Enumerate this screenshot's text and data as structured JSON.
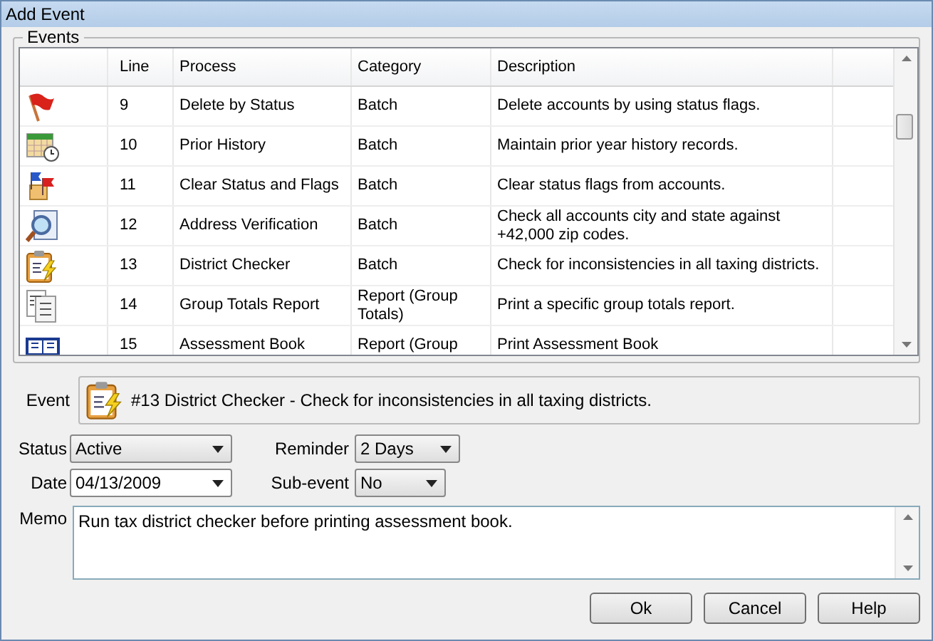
{
  "window": {
    "title": "Add Event"
  },
  "events": {
    "label": "Events",
    "columns": [
      "Line",
      "Process",
      "Category",
      "Description"
    ],
    "rows": [
      {
        "kind": "flag",
        "line": "9",
        "process": "Delete by Status",
        "category": "Batch",
        "description": "Delete accounts by using status flags."
      },
      {
        "kind": "calendar",
        "line": "10",
        "process": "Prior History",
        "category": "Batch",
        "description": "Maintain prior year history records."
      },
      {
        "kind": "flags",
        "line": "11",
        "process": "Clear Status and Flags",
        "category": "Batch",
        "description": "Clear status flags from accounts."
      },
      {
        "kind": "magnifier",
        "line": "12",
        "process": "Address Verification",
        "category": "Batch",
        "description": "Check all accounts city and state against +42,000 zip codes."
      },
      {
        "kind": "clipboard",
        "line": "13",
        "process": "District Checker",
        "category": "Batch",
        "description": "Check for inconsistencies in all taxing districts."
      },
      {
        "kind": "report",
        "line": "14",
        "process": "Group Totals Report",
        "category": "Report (Group Totals)",
        "description": "Print a specific group totals report."
      },
      {
        "kind": "book",
        "line": "15",
        "process": "Assessment Book",
        "category": "Report (Group",
        "description": "Print Assessment Book"
      }
    ]
  },
  "event": {
    "label": "Event",
    "kind": "clipboard",
    "text": "#13 District Checker - Check for inconsistencies in all taxing districts."
  },
  "status": {
    "label": "Status",
    "value": "Active"
  },
  "reminder": {
    "label": "Reminder",
    "value": "2 Days"
  },
  "date": {
    "label": "Date",
    "value": "04/13/2009"
  },
  "sub_event": {
    "label": "Sub-event",
    "value": "No"
  },
  "memo": {
    "label": "Memo",
    "value": "Run tax district checker before printing assessment book."
  },
  "buttons": [
    "Ok",
    "Cancel",
    "Help"
  ]
}
